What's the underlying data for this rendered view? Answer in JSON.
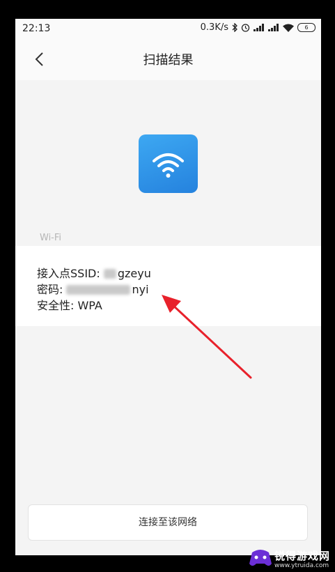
{
  "status_bar": {
    "time": "22:13",
    "net_speed": "0.3K/s",
    "icons": [
      "bluetooth-icon",
      "alarm-icon",
      "signal-icon",
      "signal-icon",
      "wifi-icon",
      "battery-icon"
    ],
    "battery_level": "6"
  },
  "nav": {
    "title": "扫描结果",
    "back_icon": "chevron-left-icon"
  },
  "wifi_icon": {
    "name": "wifi-icon",
    "tile_color": "#2e95e8"
  },
  "section": {
    "label": "Wi-Fi"
  },
  "details": {
    "ssid_label": "接入点SSID: ",
    "ssid_value": "gzeyu",
    "password_label": "密码: ",
    "password_value": "nyi",
    "security_label": "安全性: ",
    "security_value": "WPA"
  },
  "annotation": {
    "arrow_color": "#e8212b"
  },
  "button": {
    "connect_label": "连接至该网络"
  },
  "watermark": {
    "brand": "锐得游戏网",
    "url": "www.ytruida.com"
  }
}
